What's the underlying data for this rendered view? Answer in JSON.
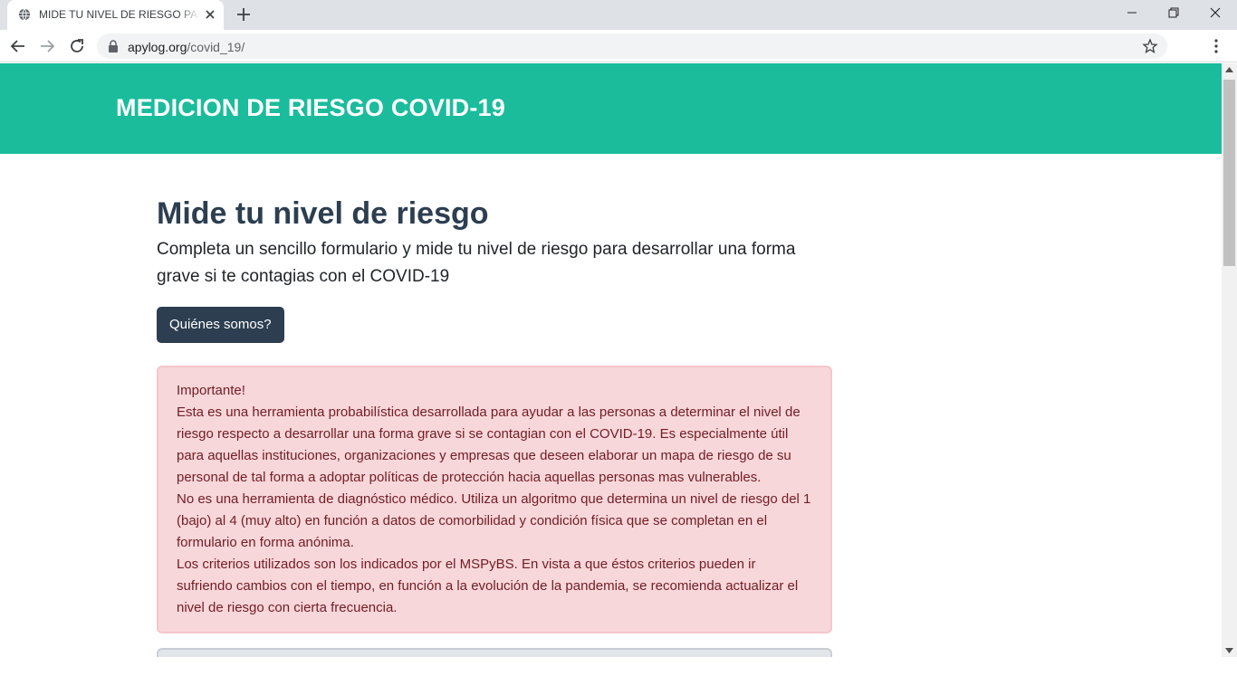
{
  "browser": {
    "tab": {
      "title": "MIDE TU NIVEL DE RIESGO PARA",
      "favicon": "globe-icon",
      "close_icon": "close-icon"
    },
    "new_tab_icon": "plus-icon",
    "window_controls": [
      "minimize-icon",
      "maximize-icon",
      "close-icon"
    ],
    "nav": [
      "back-arrow-icon",
      "forward-arrow-icon",
      "reload-icon"
    ],
    "address": {
      "host": "apylog.org",
      "path": "/covid_19/",
      "lock_icon": "lock-icon",
      "bookmark_icon": "star-icon"
    },
    "menu_icon": "kebab-menu-icon"
  },
  "site": {
    "brand": "MEDICION DE RIESGO COVID-19",
    "brand_color": "#1abc9c",
    "primary_color": "#2c3e50"
  },
  "main": {
    "title": "Mide tu nivel de riesgo",
    "lead": "Completa un sencillo formulario y mide tu nivel de riesgo para desarrollar una forma grave si te contagias con el COVID-19",
    "about_button": "Quiénes somos?",
    "alert": {
      "heading": "Importante!",
      "paragraph_1": "Esta es una herramienta probabilística desarrollada para ayudar a las personas a determinar el nivel de riesgo respecto a desarrollar una forma grave si se contagian con el COVID-19. Es especialmente útil para aquellas instituciones, organizaciones y empresas que deseen elaborar un mapa de riesgo de su personal de tal forma a adoptar políticas de protección hacia aquellas personas mas vulnerables.",
      "paragraph_2": "No es una herramienta de diagnóstico médico. Utiliza un algoritmo que determina un nivel de riesgo del 1 (bajo) al 4 (muy alto) en función a datos de comorbilidad y condición física que se completan en el formulario en forma anónima.",
      "paragraph_3": "Los criterios utilizados son los indicados por el MSPyBS. En vista a que éstos criterios pueden ir sufriendo cambios con el tiempo, en función a la evolución de la pandemia, se recomienda actualizar el nivel de riesgo con cierta frecuencia.",
      "background": "#f8d7da",
      "text_color": "#721c24"
    }
  }
}
